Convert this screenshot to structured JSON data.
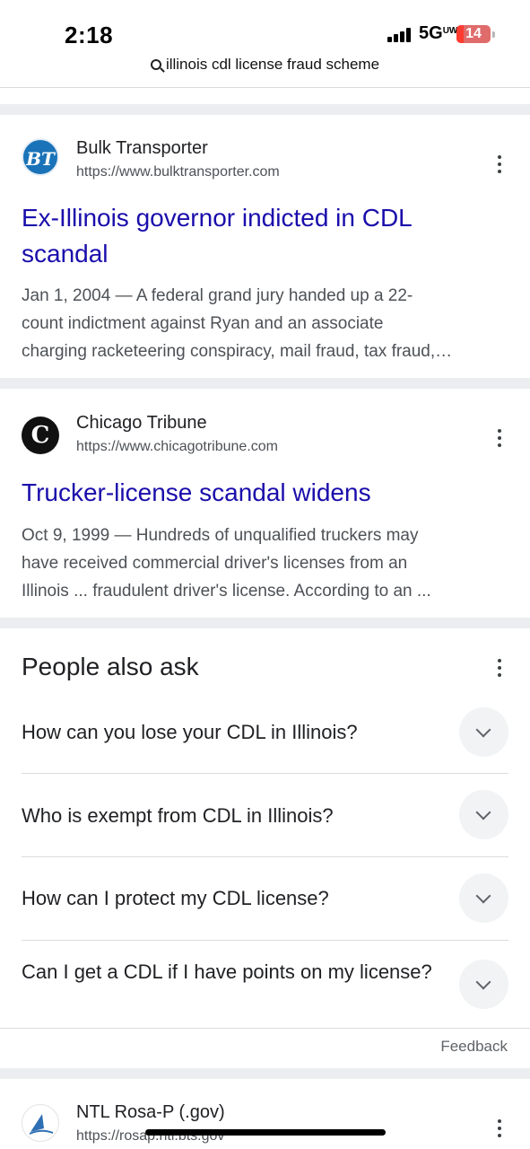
{
  "status_bar": {
    "time": "2:18",
    "network": "5G",
    "network_suffix": "UW",
    "battery": "14"
  },
  "search": {
    "query": "illinois cdl license fraud scheme",
    "icon": "search-icon"
  },
  "results": [
    {
      "favicon_text": "BT",
      "site": "Bulk Transporter",
      "url": "https://www.bulktransporter.com",
      "title_line1": "Ex-Illinois governor indicted in CDL",
      "title_line2": "scandal",
      "snippet_line1": "Jan 1, 2004 — A federal grand jury handed up a 22-",
      "snippet_line2": "count indictment against Ryan and an associate",
      "snippet_line3": "charging racketeering conspiracy, mail fraud, tax fraud,…"
    },
    {
      "favicon_text": "C",
      "site": "Chicago Tribune",
      "url": "https://www.chicagotribune.com",
      "title_line1": "Trucker-license scandal widens",
      "snippet_line1": "Oct 9, 1999 — Hundreds of unqualified truckers may",
      "snippet_line2": "have received commercial driver's licenses from an",
      "snippet_line3": "Illinois ... fraudulent driver's license. According to an ..."
    },
    {
      "site": "NTL Rosa-P (.gov)",
      "url": "https://rosap.ntl.bts.gov"
    }
  ],
  "people_also_ask": {
    "heading": "People also ask",
    "questions": [
      "How can you lose your CDL in Illinois?",
      "Who is exempt from CDL in Illinois?",
      "How can I protect my CDL license?",
      "Can I get a CDL if I have points on my license?"
    ],
    "feedback": "Feedback"
  },
  "colors": {
    "link": "#1a0dab",
    "separator": "#ebedf0",
    "battery_low": "#ff3b30"
  }
}
